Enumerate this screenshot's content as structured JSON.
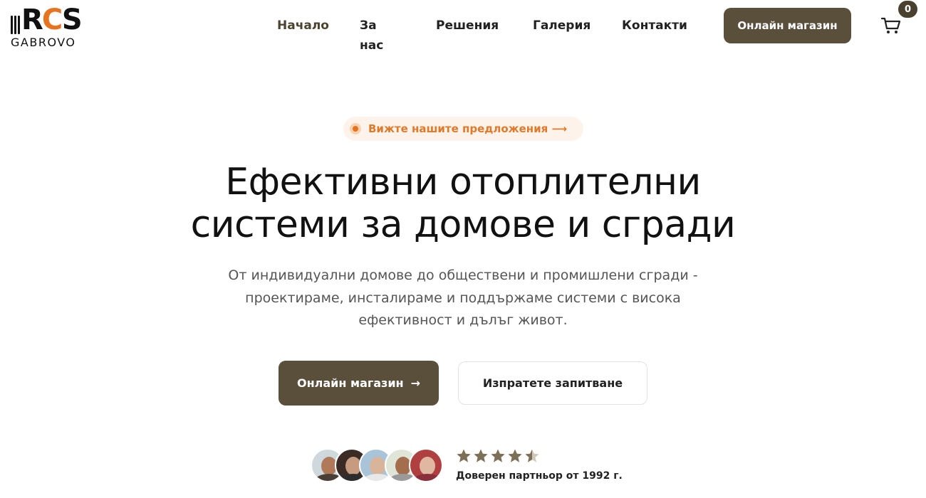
{
  "logo": {
    "letters_1": "R",
    "letters_2": "C",
    "letters_3": "S",
    "sub": "GABROVO"
  },
  "nav": {
    "items": [
      {
        "label": "Начало"
      },
      {
        "label": "За нас"
      },
      {
        "label": "Решения"
      },
      {
        "label": "Галерия"
      },
      {
        "label": "Контакти"
      }
    ],
    "shop_label": "Онлайн магазин",
    "cart_count": "0"
  },
  "hero": {
    "pill_label": "Вижте нашите предложения ⟶",
    "title_line1": "Ефективни отоплителни",
    "title_line2": "системи за домове и сгради",
    "subtitle_line1": "От индивидуални домове до обществени и промишлени сгради -",
    "subtitle_line2": "проектираме, инсталираме и поддържаме системи с висока",
    "subtitle_line3": "ефективност и дълъг живот.",
    "primary_label": "Онлайн магазин",
    "primary_arrow": "→",
    "secondary_label": "Изпратете запитване"
  },
  "rating": {
    "stars": 4.5,
    "max": 5,
    "text": "Доверен партньор от 1992 г."
  },
  "colors": {
    "accent_dark": "#5a4f3a",
    "accent_orange": "#e8731f",
    "star": "#7b6f55"
  },
  "icons": {
    "cart": "cart-icon",
    "arrow": "arrow-right-icon",
    "star": "star-icon"
  }
}
